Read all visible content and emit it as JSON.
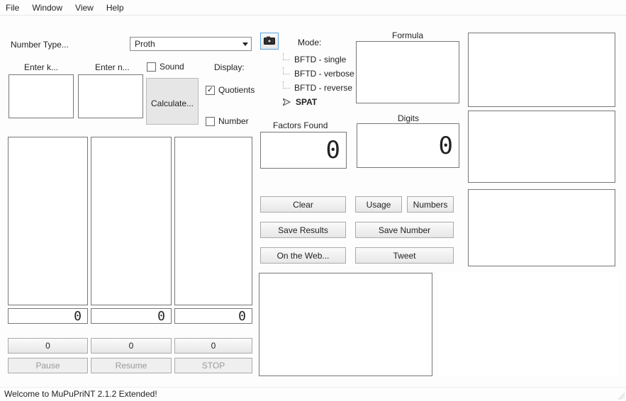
{
  "menu": {
    "file": "File",
    "window": "Window",
    "view": "View",
    "help": "Help"
  },
  "labels": {
    "numberType": "Number Type...",
    "enterK": "Enter k...",
    "enterN": "Enter n...",
    "sound": "Sound",
    "display": "Display:",
    "quotients": "Quotients",
    "number": "Number",
    "mode": "Mode:",
    "factorsFound": "Factors Found",
    "formula": "Formula",
    "digits": "Digits"
  },
  "combo": {
    "numberType": "Proth"
  },
  "buttons": {
    "calculate": "Calculate...",
    "clear": "Clear",
    "usage": "Usage",
    "numbers": "Numbers",
    "saveResults": "Save Results",
    "saveNumber": "Save Number",
    "onTheWeb": "On the Web...",
    "tweet": "Tweet",
    "pause": "Pause",
    "resume": "Resume",
    "stop": "STOP"
  },
  "tree": {
    "items": [
      "BFTD - single",
      "BFTD - verbose",
      "BFTD - reverse",
      "SPAT"
    ],
    "activeIndex": 3
  },
  "sevenseg": {
    "factors": "0",
    "digits": "0",
    "small1": "0",
    "small2": "0",
    "small3": "0",
    "counter1": "0",
    "counter2": "0",
    "counter3": "0"
  },
  "status": "Welcome to MuPuPriNT 2.1.2 Extended!",
  "icons": {
    "camera": "camera-icon"
  }
}
